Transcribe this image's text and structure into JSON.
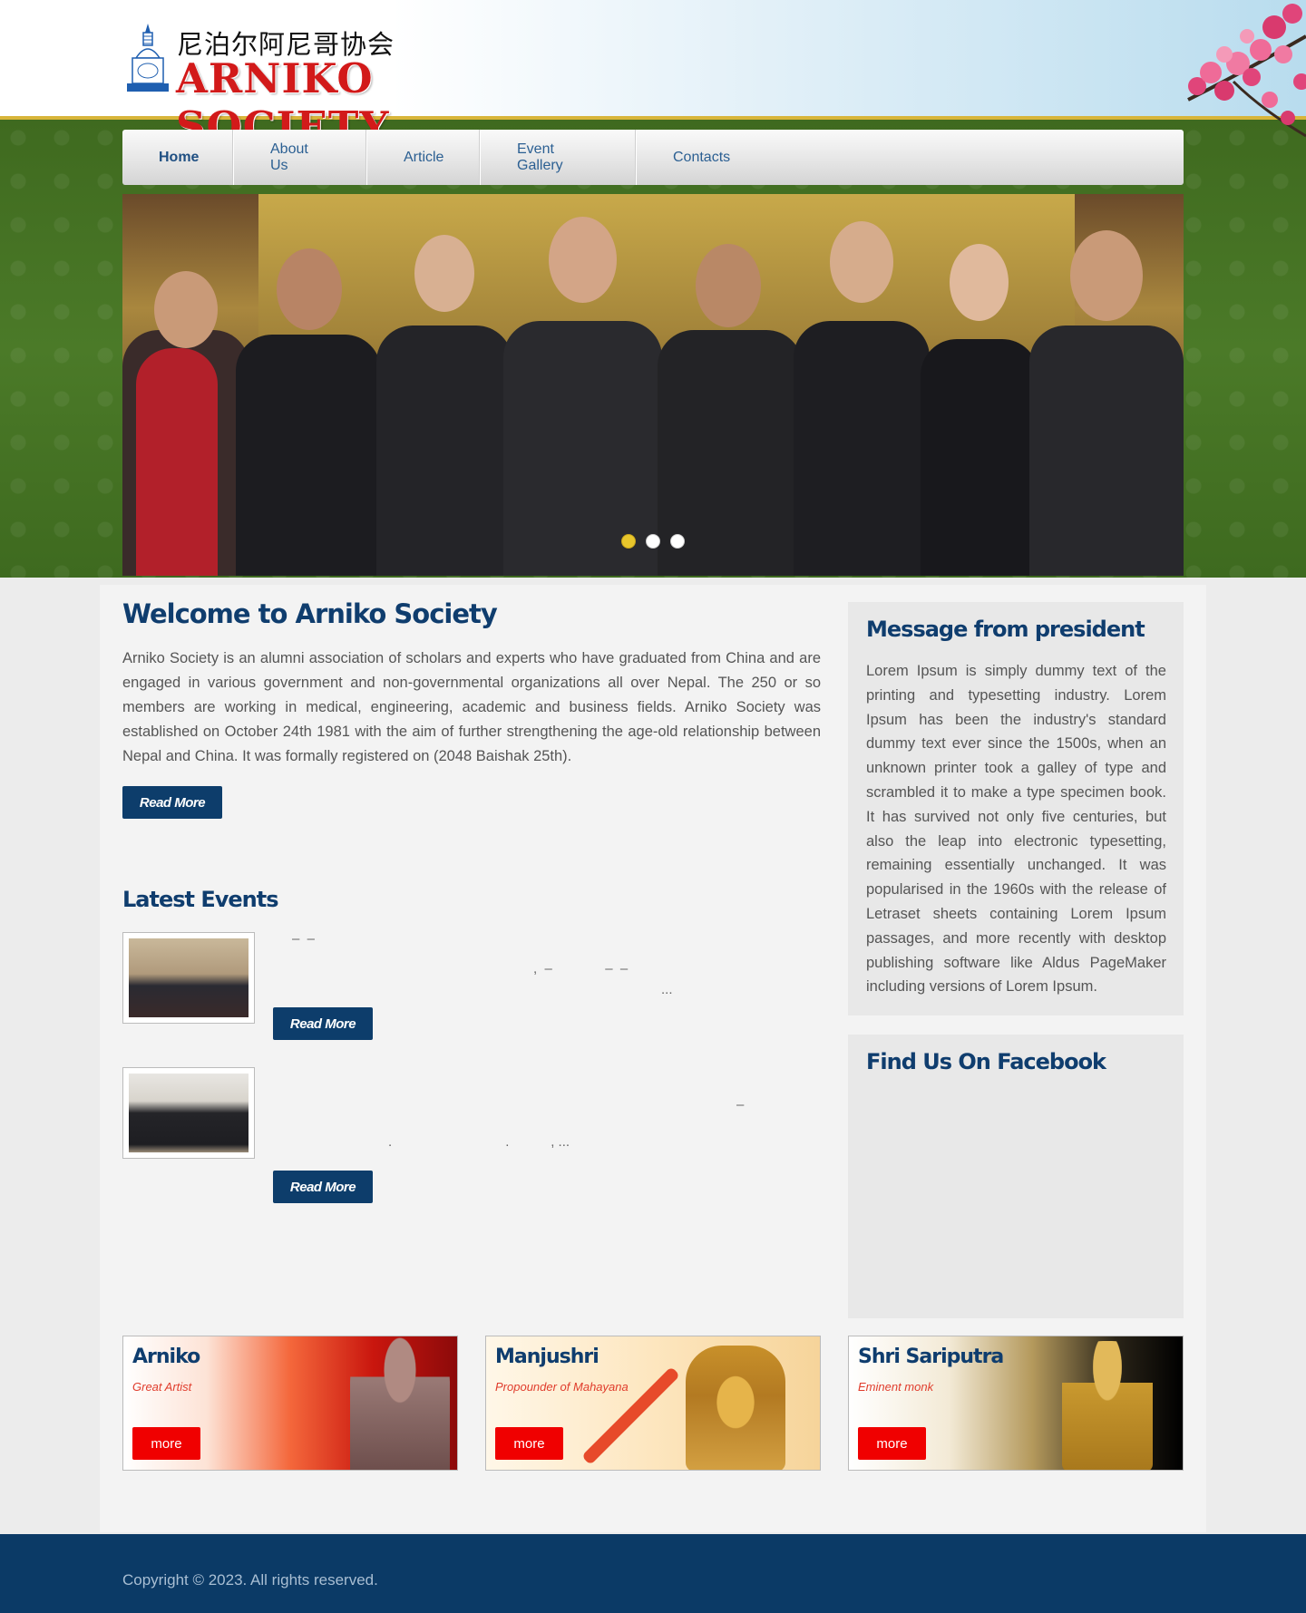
{
  "header": {
    "logo_cn": "尼泊尔阿尼哥协会",
    "logo_en": "ARNIKO SOCIETY"
  },
  "nav": {
    "items": [
      {
        "label": "Home",
        "active": true
      },
      {
        "label": "About Us",
        "active": false
      },
      {
        "label": "Article",
        "active": false
      },
      {
        "label": "Event Gallery",
        "active": false
      },
      {
        "label": "Contacts",
        "active": false
      }
    ]
  },
  "slider": {
    "dots": 3,
    "active_dot": 1
  },
  "welcome": {
    "title": "Welcome to Arniko Society",
    "text": "Arniko Society is an alumni association of scholars and experts who have graduated from China and are engaged in various government and non-governmental organizations all over Nepal. The 250 or so members are working in medical, engineering, academic and business fields. Arniko Society was established on October 24th 1981 with the aim of further strengthening the age-old relationship between Nepal and China. It was formally registered on (2048 Baishak 25th).",
    "read_more": "Read More"
  },
  "events": {
    "title": "Latest Events",
    "items": [
      {
        "line1": "–  –",
        "line2": ",  –              –  –",
        "line3": "...",
        "read_more": "Read More"
      },
      {
        "line1": "–",
        "line2": ".                              .           , ...",
        "read_more": "Read More"
      }
    ]
  },
  "sidebar": {
    "message_title": "Message from president",
    "message_text": "Lorem Ipsum is simply dummy text of the printing and typesetting industry. Lorem Ipsum has been the industry's standard dummy text ever since the 1500s, when an unknown printer took a galley of type and scrambled it to make a type specimen book. It has survived not only five centuries, but also the leap into electronic typesetting, remaining essentially unchanged. It was popularised in the 1960s with the release of Letraset sheets containing Lorem Ipsum passages, and more recently with desktop publishing software like Aldus PageMaker including versions of Lorem Ipsum.",
    "facebook_title": "Find Us On Facebook"
  },
  "cards": [
    {
      "name": "Arniko",
      "subtitle": "Great Artist",
      "more": "more"
    },
    {
      "name": "Manjushri",
      "subtitle": "Propounder of Mahayana",
      "more": "more"
    },
    {
      "name": "Shri Sariputra",
      "subtitle": "Eminent monk",
      "more": "more"
    }
  ],
  "footer": {
    "copyright": "Copyright © 2023. All rights reserved."
  },
  "colors": {
    "brand_blue": "#0f3d6e",
    "footer_blue": "#0b3a66",
    "logo_red": "#d21a1a",
    "more_red": "#f00000",
    "slider_dot_active": "#e8c62c"
  }
}
